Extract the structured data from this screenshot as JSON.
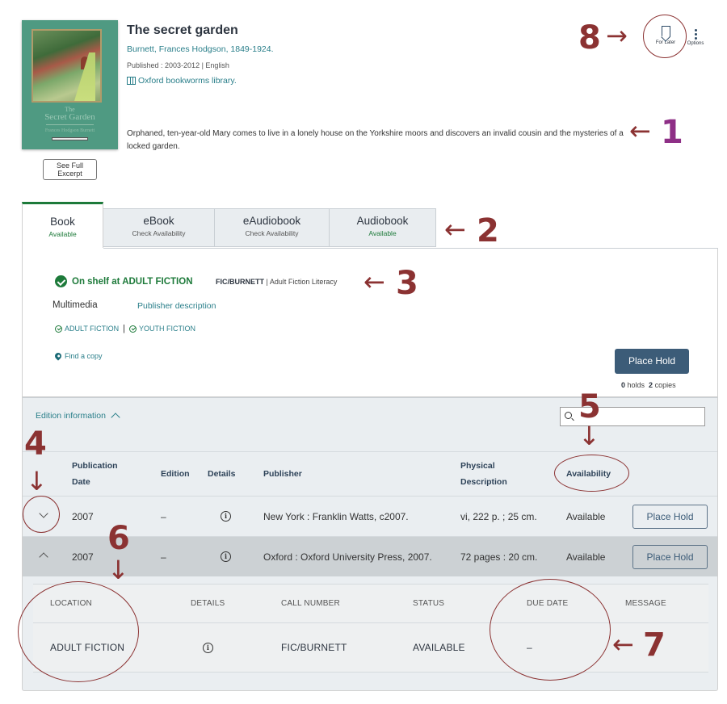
{
  "record": {
    "cover": {
      "title_line1": "The",
      "title_line2": "Secret Garden",
      "author": "Frances Hodgson Burnett",
      "colors": {
        "background": "#4f9a82",
        "frame": "#b19b6a"
      }
    },
    "excerpt_button": "See Full\nExcerpt",
    "title": "The secret garden",
    "author": "Burnett, Frances Hodgson, 1849-1924.",
    "published": "Published : 2003-2012 | English",
    "series": "Oxford bookworms library.",
    "summary": "Orphaned, ten-year-old Mary comes to live in a lonely house on the Yorkshire moors and discovers an invalid cousin and the mysteries of a locked garden.",
    "actions": {
      "for_later": "For Later",
      "options": "Options"
    }
  },
  "tabs": [
    {
      "name": "Book",
      "status": "Available",
      "status_color": "green",
      "active": true
    },
    {
      "name": "eBook",
      "status": "Check Availability",
      "status_color": "gray",
      "active": false
    },
    {
      "name": "eAudiobook",
      "status": "Check Availability",
      "status_color": "gray",
      "active": false
    },
    {
      "name": "Audiobook",
      "status": "Available",
      "status_color": "green",
      "active": false
    }
  ],
  "availability": {
    "on_shelf": "On shelf at ADULT FICTION",
    "call_number": "FIC/BURNETT",
    "collection": " | Adult Fiction Literacy",
    "multimedia": "Multimedia",
    "publisher_description": "Publisher description",
    "locations": [
      "ADULT FICTION",
      "YOUTH FICTION"
    ],
    "location_separator": "|",
    "find_copy": "Find a copy",
    "place_hold": "Place Hold",
    "holds_count": "0",
    "holds_label": " holds  ",
    "copies_count": "2",
    "copies_label": " copies"
  },
  "editions": {
    "toggle_label": "Edition information",
    "search": {
      "value": "",
      "placeholder": ""
    },
    "headers": {
      "publication_date": "Publication Date",
      "edition": "Edition",
      "details": "Details",
      "publisher": "Publisher",
      "physical_description": "Physical Description",
      "availability": "Availability"
    },
    "rows": [
      {
        "expanded": false,
        "publication_date": "2007",
        "edition": "–",
        "publisher": "New York : Franklin Watts, c2007.",
        "physical_description": "vi, 222 p. ; 25 cm.",
        "availability": "Available",
        "action": "Place Hold"
      },
      {
        "expanded": true,
        "publication_date": "2007",
        "edition": "–",
        "publisher": "Oxford : Oxford University Press, 2007.",
        "physical_description": "72 pages : 20 cm.",
        "availability": "Available",
        "action": "Place Hold"
      }
    ],
    "items": {
      "headers": {
        "location": "LOCATION",
        "details": "DETAILS",
        "call_number": "CALL NUMBER",
        "status": "STATUS",
        "due_date": "DUE DATE",
        "message": "MESSAGE"
      },
      "rows": [
        {
          "location": "ADULT FICTION",
          "call_number": "FIC/BURNETT",
          "status": "AVAILABLE",
          "due_date": "–",
          "message": ""
        }
      ]
    }
  },
  "annotations": {
    "labels": [
      "1",
      "2",
      "3",
      "4",
      "5",
      "6",
      "7",
      "8"
    ],
    "arrow_left": "←",
    "arrow_right": "→",
    "arrow_down": "↓",
    "colors": {
      "primary": "#8b3232",
      "accent": "#8e2f86"
    }
  },
  "colors": {
    "link": "#2a7f8a",
    "available_green": "#1d7a3a",
    "button_primary": "#3c5c78",
    "heading": "#2d3540",
    "panel_gray": "#eaeef1",
    "expanded_row": "#ccd1d4"
  }
}
